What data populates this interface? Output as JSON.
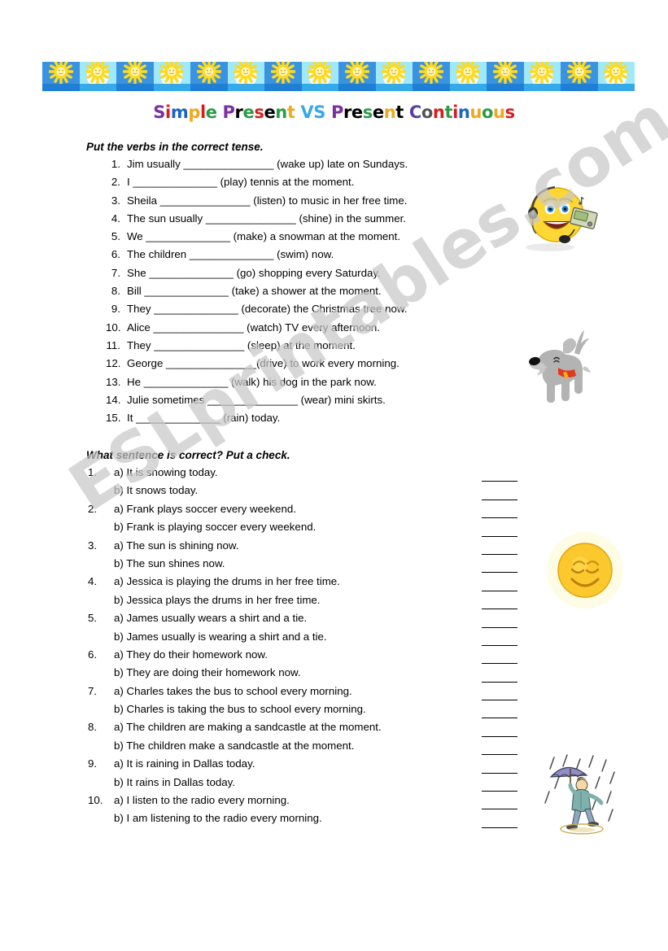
{
  "title": {
    "text": "Simple Present VS Present Continuous",
    "letters": [
      {
        "c": "S",
        "color": "#7b2fa0"
      },
      {
        "c": "i",
        "color": "#d81c1c"
      },
      {
        "c": "m",
        "color": "#1b64c4"
      },
      {
        "c": "p",
        "color": "#f0a81e"
      },
      {
        "c": "l",
        "color": "#d81c1c"
      },
      {
        "c": "e",
        "color": "#2a9b46"
      },
      {
        "c": " ",
        "color": "#000000"
      },
      {
        "c": "P",
        "color": "#7b2fa0"
      },
      {
        "c": "r",
        "color": "#000000"
      },
      {
        "c": "e",
        "color": "#2a9b46"
      },
      {
        "c": "s",
        "color": "#d81c1c"
      },
      {
        "c": "e",
        "color": "#000000"
      },
      {
        "c": "n",
        "color": "#2a9b46"
      },
      {
        "c": "t",
        "color": "#f0a81e"
      },
      {
        "c": " ",
        "color": "#000000"
      },
      {
        "c": "V",
        "color": "#3aa8e8"
      },
      {
        "c": "S",
        "color": "#3aa8e8"
      },
      {
        "c": " ",
        "color": "#000000"
      },
      {
        "c": "P",
        "color": "#7b2fa0"
      },
      {
        "c": "r",
        "color": "#000000"
      },
      {
        "c": "e",
        "color": "#000000"
      },
      {
        "c": "s",
        "color": "#2a9b46"
      },
      {
        "c": "e",
        "color": "#000000"
      },
      {
        "c": "n",
        "color": "#f0a81e"
      },
      {
        "c": "t",
        "color": "#000000"
      },
      {
        "c": " ",
        "color": "#000000"
      },
      {
        "c": "C",
        "color": "#5b3fa8"
      },
      {
        "c": "o",
        "color": "#555555"
      },
      {
        "c": "n",
        "color": "#d81c1c"
      },
      {
        "c": "t",
        "color": "#2a9b46"
      },
      {
        "c": "i",
        "color": "#d81c1c"
      },
      {
        "c": "n",
        "color": "#1b64c4"
      },
      {
        "c": "u",
        "color": "#f0a81e"
      },
      {
        "c": "o",
        "color": "#2a9b46"
      },
      {
        "c": "u",
        "color": "#f0a81e"
      },
      {
        "c": "s",
        "color": "#d81c1c"
      }
    ]
  },
  "watermark": {
    "text": "ESLprintables.com"
  },
  "banner": {
    "tile_count": 16,
    "dark_color": "#3a93e0",
    "light_color": "#9fe9fb",
    "sun_color": "#ffd91e",
    "icon": "sun-over-water-tile"
  },
  "exercise1": {
    "heading": "Put the verbs in the correct tense.",
    "items": [
      {
        "num": "1.",
        "text": "Jim usually _______________ (wake up) late on Sundays."
      },
      {
        "num": "2.",
        "text": "I ______________ (play) tennis at the moment."
      },
      {
        "num": "3.",
        "text": "Sheila _______________ (listen) to music in her free time."
      },
      {
        "num": "4.",
        "text": "The sun usually _______________ (shine) in the summer."
      },
      {
        "num": "5.",
        "text": "We ______________ (make) a snowman at the moment."
      },
      {
        "num": "6.",
        "text": "The children ______________ (swim) now."
      },
      {
        "num": "7.",
        "text": "She ______________ (go) shopping every Saturday."
      },
      {
        "num": "8.",
        "text": "Bill ______________ (take) a shower at the moment."
      },
      {
        "num": "9.",
        "text": "They ______________ (decorate) the Christmas tree now."
      },
      {
        "num": "10.",
        "text": "Alice _______________ (watch) TV every afternoon."
      },
      {
        "num": "11.",
        "text": "They _______________ (sleep) at the moment."
      },
      {
        "num": "12.",
        "text": "George _______________(drive) to work every morning."
      },
      {
        "num": "13.",
        "text": "He ______________ (walk) his dog in the park now."
      },
      {
        "num": "14.",
        "text": "Julie sometimes _______________ (wear) mini skirts."
      },
      {
        "num": "15.",
        "text": "It ______________ (rain) today."
      }
    ]
  },
  "exercise2": {
    "heading": "What sentence is correct? Put a check.",
    "items": [
      {
        "num": "1.",
        "a": "a) It is snowing today.",
        "b": "b) It snows today."
      },
      {
        "num": "2.",
        "a": "a) Frank plays soccer every weekend.",
        "b": "b) Frank is playing soccer every weekend."
      },
      {
        "num": "3.",
        "a": "a) The sun is shining now.",
        "b": "b) The sun shines now."
      },
      {
        "num": "4.",
        "a": "a) Jessica is playing the drums in her free time.",
        "b": "b) Jessica plays the drums in her free time."
      },
      {
        "num": "5.",
        "a": "a) James usually wears a shirt and a tie.",
        "b": "b) James usually is wearing a shirt and a tie."
      },
      {
        "num": "6.",
        "a": "a) They do their homework now.",
        "b": "b) They are doing their homework now."
      },
      {
        "num": "7.",
        "a": "a) Charles takes the bus to school every morning.",
        "b": "b) Charles is taking the bus to school every morning."
      },
      {
        "num": "8.",
        "a": "a) The children are making a sandcastle at the moment.",
        "b": "b) The children make a sandcastle at the moment."
      },
      {
        "num": "9.",
        "a": "a) It is raining in Dallas today.",
        "b": "b) It rains in Dallas today."
      },
      {
        "num": "10.",
        "a": "a) I listen to the radio every morning.",
        "b": "b) I am listening to the radio every morning."
      }
    ]
  },
  "artwork": {
    "smiley": "smiley-with-headphones-icon",
    "dog": "cartoon-dog-icon",
    "sun": "smiling-sun-icon",
    "rain": "person-with-umbrella-in-rain-icon"
  }
}
